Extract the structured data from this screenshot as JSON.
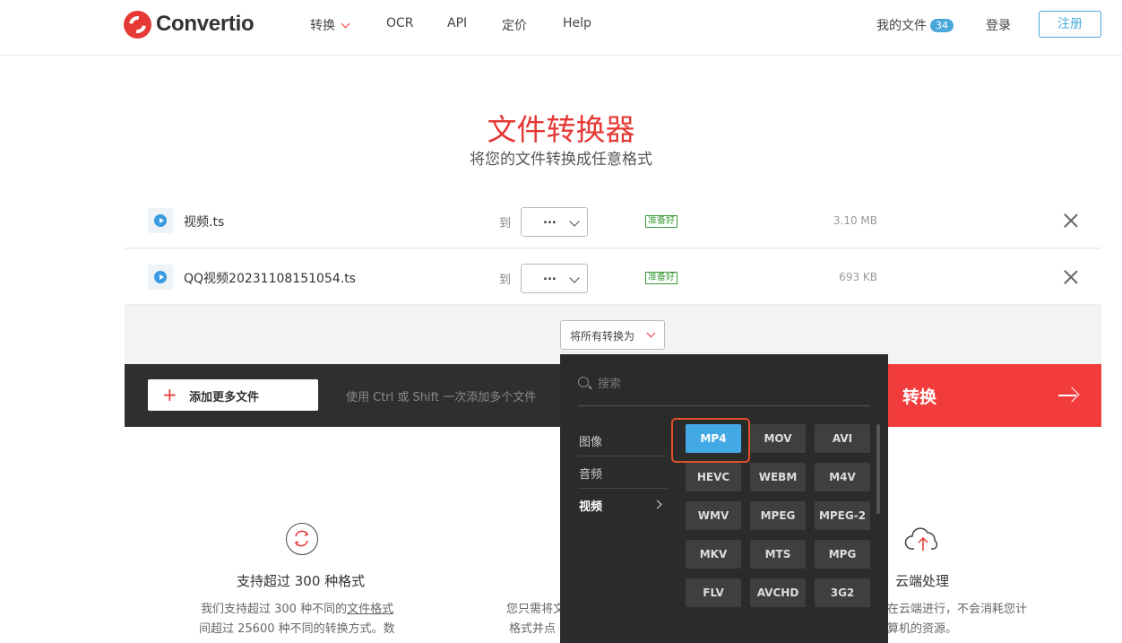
{
  "header": {
    "logo_text": "Convertio",
    "nav": [
      {
        "label": "转换",
        "has_dropdown": true
      },
      {
        "label": "OCR"
      },
      {
        "label": "API"
      },
      {
        "label": "定价"
      },
      {
        "label": "Help"
      }
    ],
    "my_files_label": "我的文件",
    "my_files_count": "34",
    "login_label": "登录",
    "register_label": "注册"
  },
  "hero": {
    "title": "文件转换器",
    "subtitle": "将您的文件转换成任意格式"
  },
  "files": [
    {
      "name": "视频.ts",
      "to_label": "到",
      "format": "...",
      "status": "准备好",
      "size": "3.10 MB"
    },
    {
      "name": "QQ视频20231108151054.ts",
      "to_label": "到",
      "format": "...",
      "status": "准备好",
      "size": "693 KB"
    }
  ],
  "convert_all_label": "将所有转换为",
  "action_bar": {
    "add_more_label": "添加更多文件",
    "hint": "使用 Ctrl 或 Shift 一次添加多个文件",
    "convert_label": "转换"
  },
  "features": [
    {
      "title": "支持超过 300 种格式",
      "line1_pre": "我们支持超过 300 种不同的",
      "line1_link": "文件格式",
      "line2": "间超过 25600 种不同的转换方式。数"
    },
    {
      "line1": "您只需将文",
      "line2": "格式并点"
    },
    {
      "title": "云端处理",
      "line1": "在云端进行，不会消耗您计",
      "line2": "算机的资源。"
    }
  ],
  "dropdown": {
    "search_placeholder": "搜索",
    "categories": [
      {
        "label": "图像"
      },
      {
        "label": "音频"
      },
      {
        "label": "视频",
        "active": true
      }
    ],
    "formats": [
      [
        "MP4",
        "MOV",
        "AVI"
      ],
      [
        "HEVC",
        "WEBM",
        "M4V"
      ],
      [
        "WMV",
        "MPEG",
        "MPEG-2"
      ],
      [
        "MKV",
        "MTS",
        "MPG"
      ],
      [
        "FLV",
        "AVCHD",
        "3G2"
      ]
    ],
    "selected_format": "MP4"
  },
  "colors": {
    "brand_red": "#e53935",
    "accent_blue": "#42a9e6",
    "convert_red": "#f23c3c"
  }
}
